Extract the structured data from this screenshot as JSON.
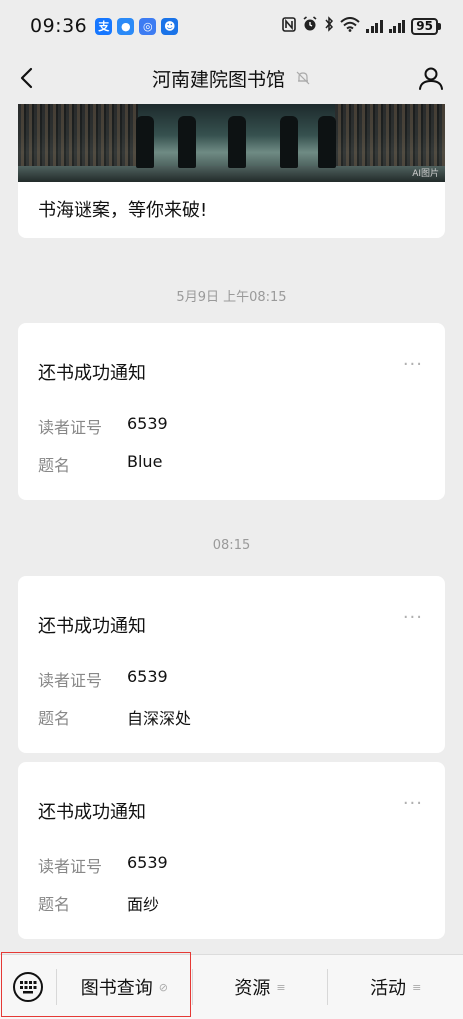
{
  "status_bar": {
    "time": "09:36",
    "battery": "95",
    "app_icons": [
      {
        "name": "alipay-icon",
        "glyph": "支",
        "color": "#1677ff"
      },
      {
        "name": "message-icon",
        "glyph": "●",
        "color": "#2b8af7"
      },
      {
        "name": "browser-icon",
        "glyph": "◎",
        "color": "#3d7cf2"
      },
      {
        "name": "robot-app-icon",
        "glyph": "☻",
        "color": "#1a73e8"
      }
    ]
  },
  "nav": {
    "title": "河南建院图书馆"
  },
  "article": {
    "title": "书海谜案，等你来破!",
    "ai_tag": "AI图片"
  },
  "timeline": [
    {
      "time": "5月9日 上午08:15"
    },
    {
      "time": "08:15"
    }
  ],
  "messages": [
    {
      "title": "还书成功通知",
      "more": "···",
      "fields": [
        {
          "label": "读者证号",
          "value": "6539"
        },
        {
          "label": "题名",
          "value": "Blue"
        }
      ]
    },
    {
      "title": "还书成功通知",
      "more": "···",
      "fields": [
        {
          "label": "读者证号",
          "value": "6539"
        },
        {
          "label": "题名",
          "value": "自深深处"
        }
      ]
    },
    {
      "title": "还书成功通知",
      "more": "···",
      "fields": [
        {
          "label": "读者证号",
          "value": "6539"
        },
        {
          "label": "题名",
          "value": "面纱"
        }
      ]
    }
  ],
  "bottom_menu": {
    "items": [
      {
        "label": "图书查询",
        "mark": "⊘"
      },
      {
        "label": "资源",
        "mark": "≡"
      },
      {
        "label": "活动",
        "mark": "≡"
      }
    ]
  },
  "colors": {
    "background": "#ededed",
    "card": "#ffffff",
    "highlight": "#e53935"
  }
}
